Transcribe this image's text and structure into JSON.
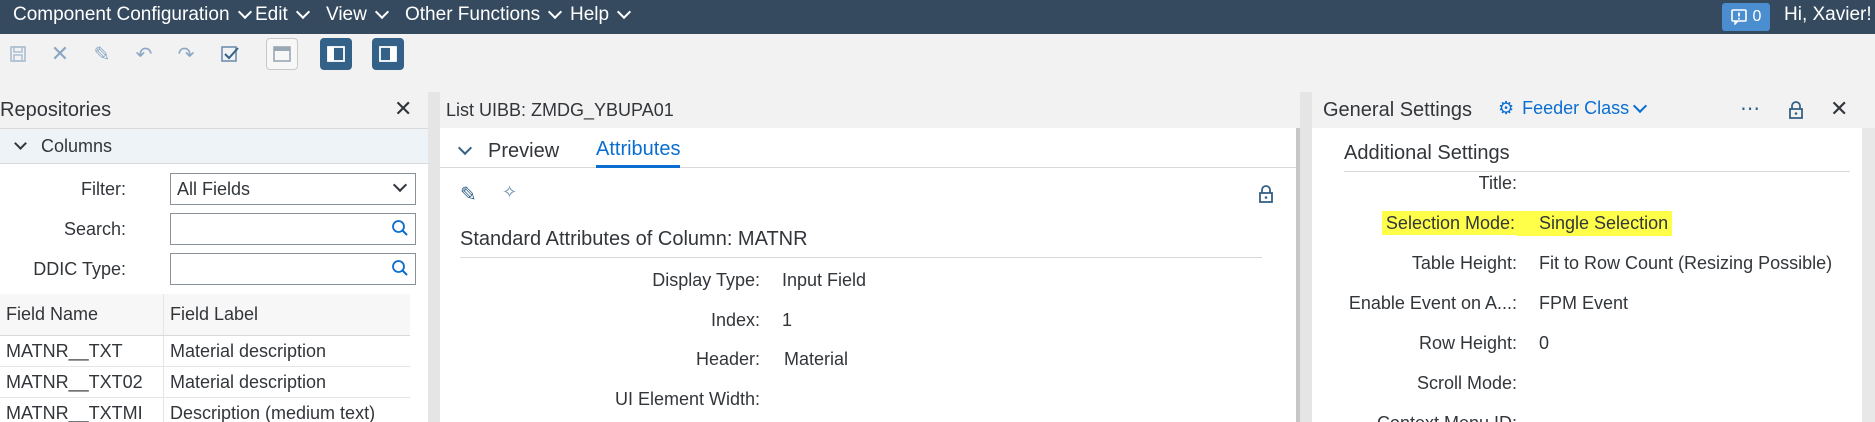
{
  "menubar": {
    "items": [
      "Component Configuration",
      "Edit",
      "View",
      "Other Functions",
      "Help"
    ],
    "notification_count": "0",
    "greeting": "Hi, Xavier!"
  },
  "toolbar": {
    "icons": [
      "save-icon",
      "cancel-icon",
      "edit-icon",
      "undo-icon",
      "redo-icon",
      "check-icon",
      "layout-header-icon",
      "left-panel-icon",
      "right-panel-icon"
    ]
  },
  "repositories": {
    "title": "Repositories",
    "section": "Columns",
    "filter_label": "Filter:",
    "filter_value": "All Fields",
    "search_label": "Search:",
    "search_value": "",
    "ddic_label": "DDIC Type:",
    "ddic_value": "",
    "table": {
      "headers": [
        "Field Name",
        "Field Label"
      ],
      "rows": [
        [
          "MATNR__TXT",
          "Material description"
        ],
        [
          "MATNR__TXT02",
          "Material description"
        ],
        [
          "MATNR__TXTMI",
          "Description (medium text)"
        ]
      ]
    }
  },
  "middle": {
    "title": "List UIBB: ZMDG_YBUPA01",
    "tabs": [
      "Preview",
      "Attributes"
    ],
    "active_tab": "Attributes",
    "section_title": "Standard Attributes of Column: MATNR",
    "fields": [
      {
        "label": "Display Type:",
        "value": "Input Field"
      },
      {
        "label": "Index:",
        "value": "1"
      },
      {
        "label": "Header:",
        "value": "Material"
      },
      {
        "label": "UI Element Width:",
        "value": ""
      }
    ]
  },
  "right": {
    "title": "General Settings",
    "feeder_class": "Feeder Class",
    "section_title": "Additional Settings",
    "fields": [
      {
        "label": "Title:",
        "value": ""
      },
      {
        "label": "Selection Mode:",
        "value": "Single Selection"
      },
      {
        "label": "Table Height:",
        "value": "Fit to Row Count (Resizing Possible)"
      },
      {
        "label": "Enable Event on A...:",
        "value": "FPM Event"
      },
      {
        "label": "Row Height:",
        "value": "0"
      },
      {
        "label": "Scroll Mode:",
        "value": ""
      },
      {
        "label": "Context Menu ID:",
        "value": ""
      }
    ],
    "highlight_color": "#ffff4a"
  },
  "colors": {
    "shell": "#354a5f",
    "accent": "#0a6ed1",
    "toolbar_active": "#346187"
  }
}
